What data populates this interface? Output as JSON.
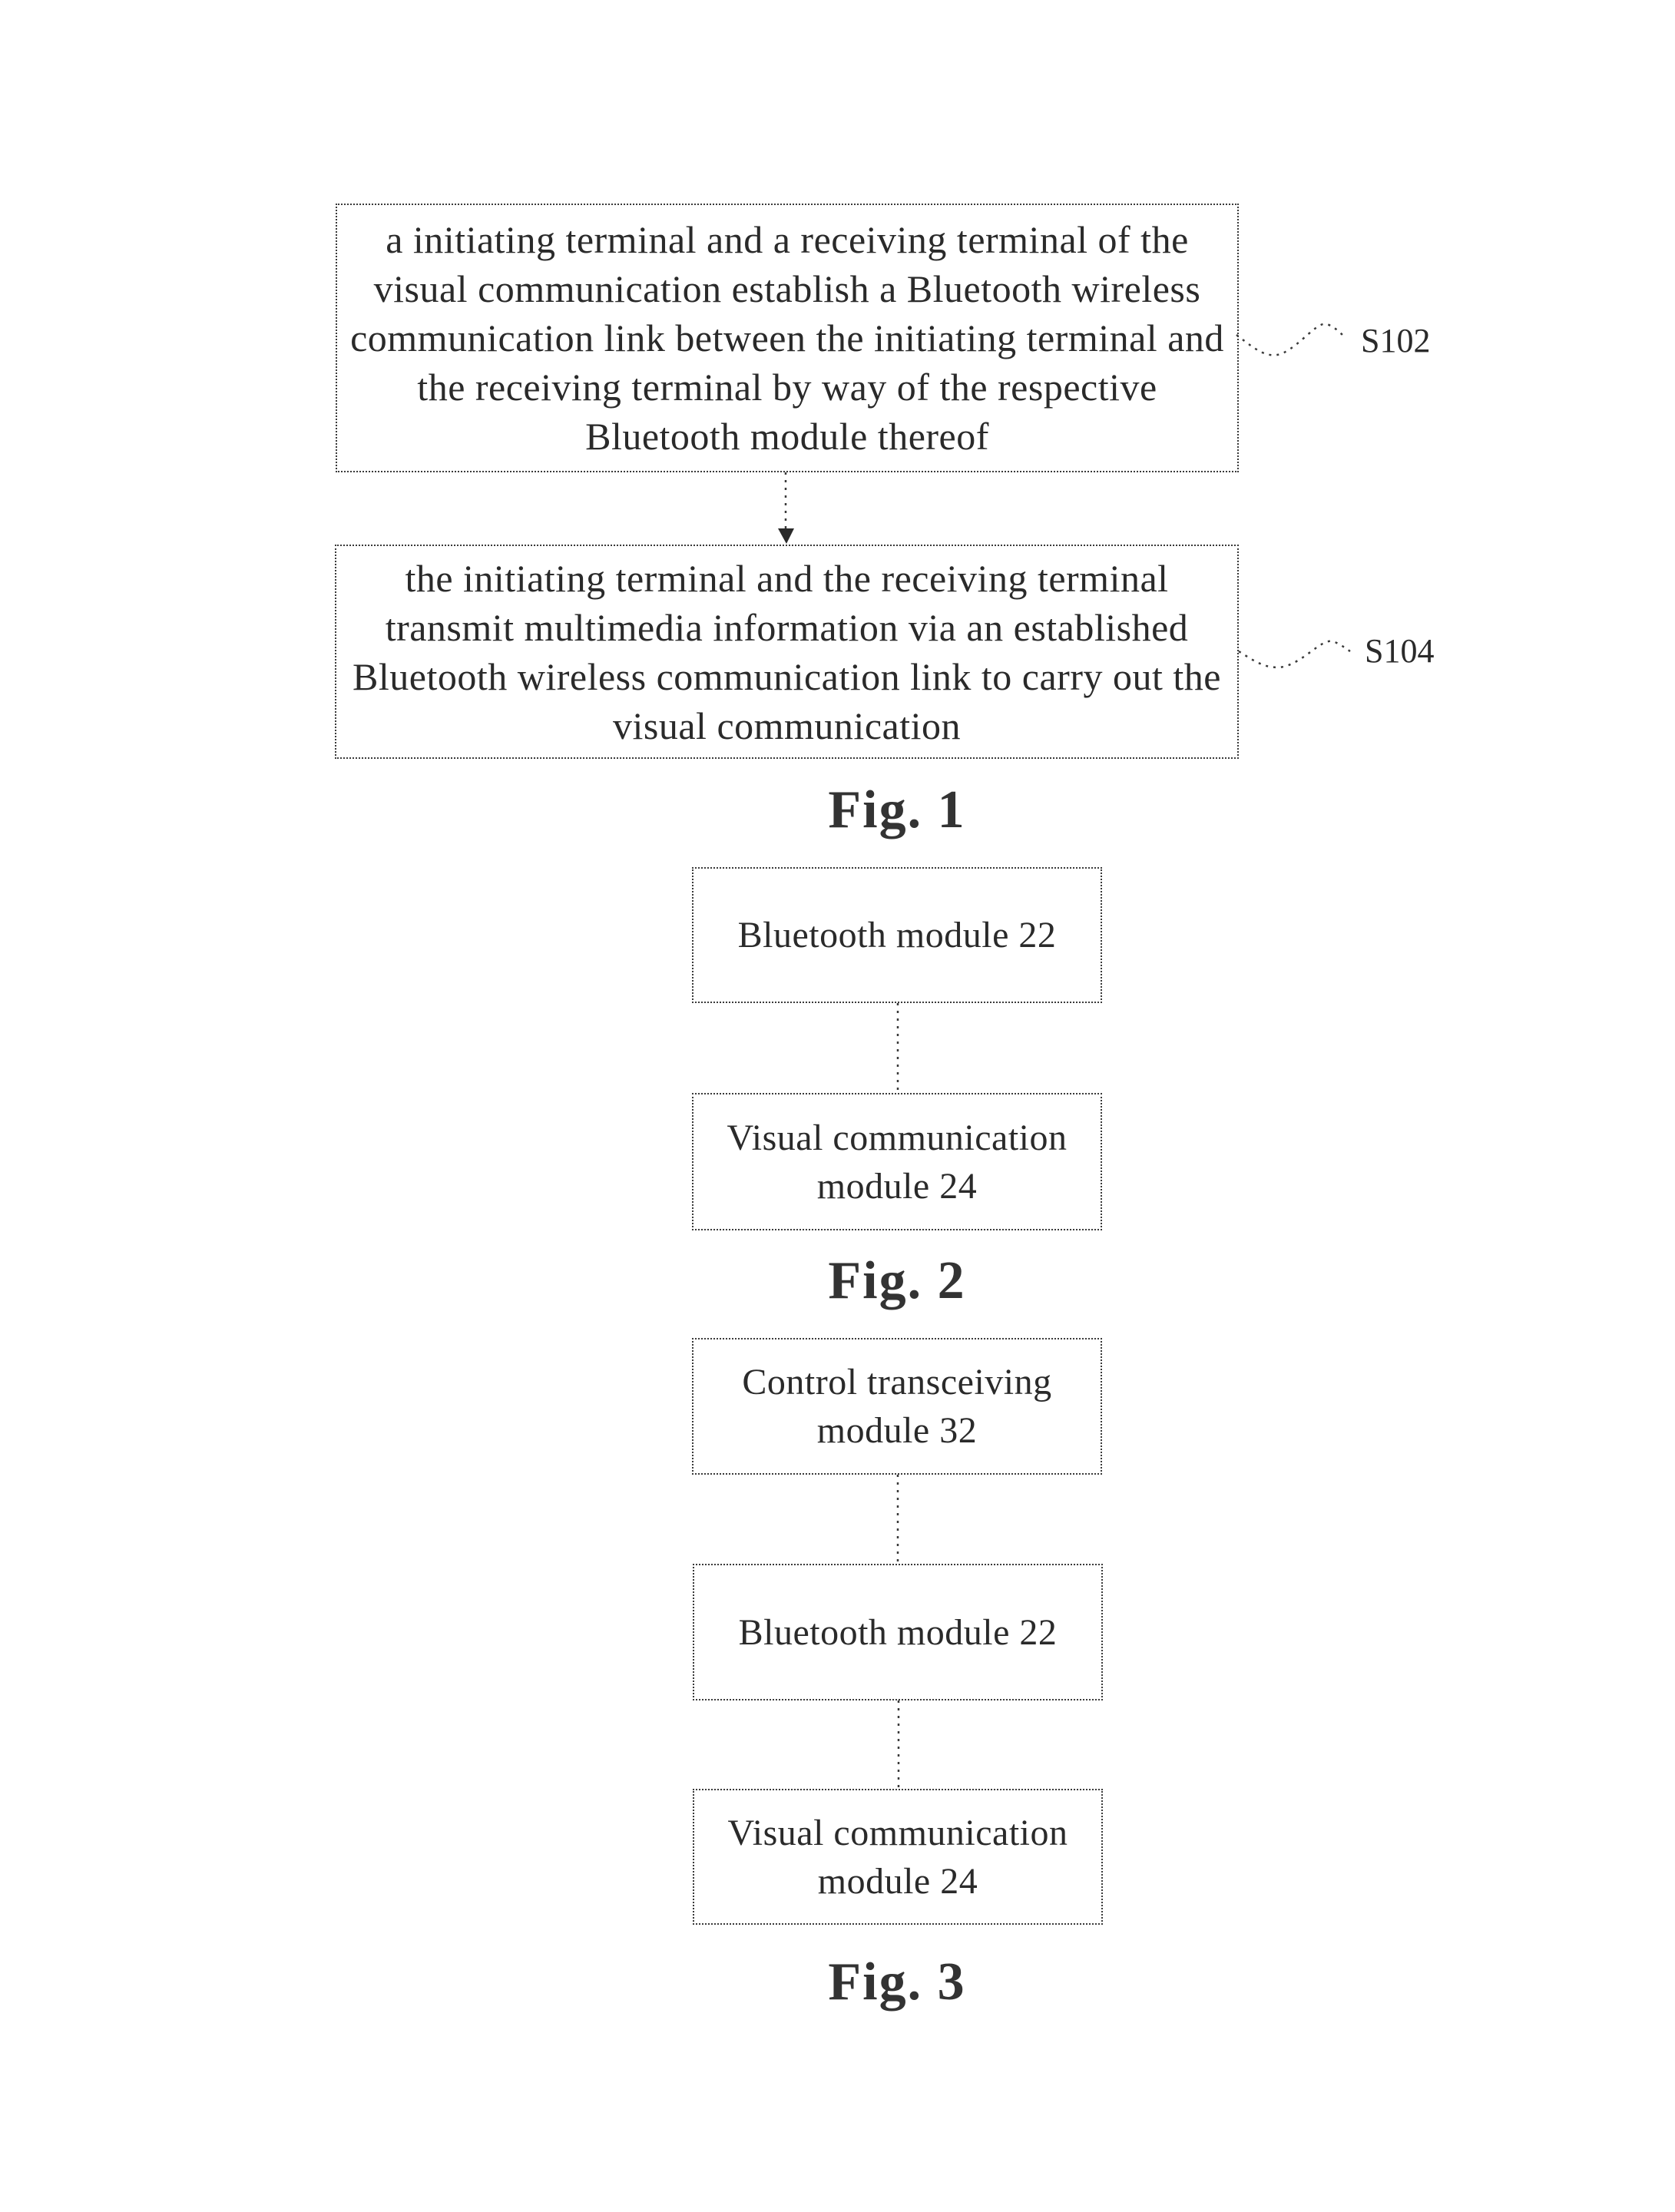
{
  "figures": [
    {
      "label": "Fig. 1",
      "type": "flowchart",
      "steps": [
        {
          "id": "S102",
          "text": "a initiating terminal and a receiving terminal of the visual communication establish a Bluetooth wireless communication link between the initiating terminal and the receiving terminal by way of the respective Bluetooth module thereof"
        },
        {
          "id": "S104",
          "text": "the initiating terminal and the receiving terminal transmit multimedia information via an established Bluetooth wireless communication link to carry out the visual communication"
        }
      ]
    },
    {
      "label": "Fig. 2",
      "type": "block-diagram",
      "blocks": [
        {
          "text": "Bluetooth module 22"
        },
        {
          "text": "Visual communication module 24"
        }
      ]
    },
    {
      "label": "Fig. 3",
      "type": "block-diagram",
      "blocks": [
        {
          "text": "Control transceiving module 32"
        },
        {
          "text": "Bluetooth module 22"
        },
        {
          "text": "Visual communication module 24"
        }
      ]
    }
  ]
}
